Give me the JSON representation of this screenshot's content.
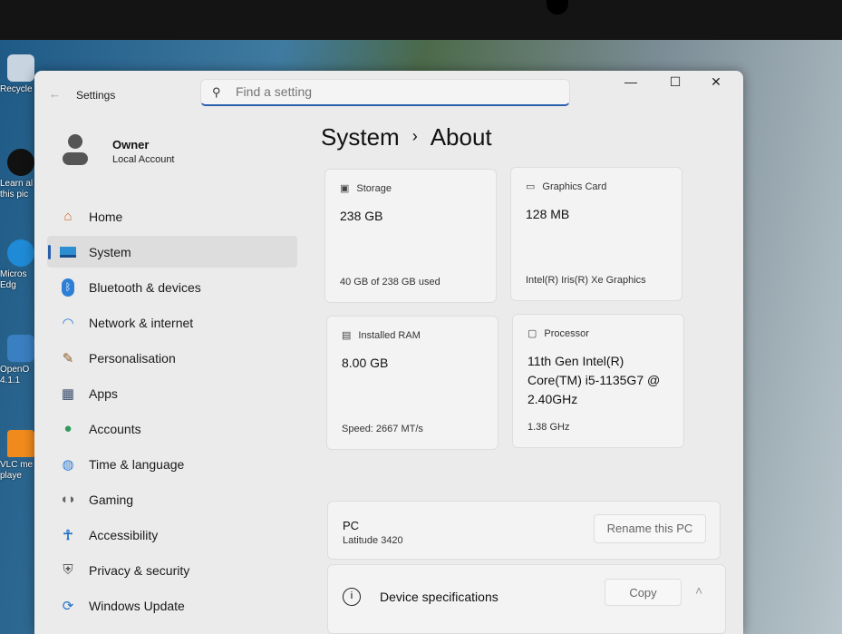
{
  "desktop": {
    "icons": [
      {
        "label": "Recycle"
      },
      {
        "label": "Learn al this pic"
      },
      {
        "label": "Micros Edg"
      },
      {
        "label": "OpenO 4.1.1"
      },
      {
        "label": "VLC me playe"
      }
    ]
  },
  "window": {
    "title": "Settings",
    "search_placeholder": "Find a setting",
    "controls": {
      "minimize": "—",
      "maximize": "☐",
      "close": "✕"
    }
  },
  "user": {
    "name": "Owner",
    "type": "Local Account"
  },
  "nav": [
    {
      "label": "Home",
      "icon": "home-icon"
    },
    {
      "label": "System",
      "icon": "system-icon",
      "selected": true
    },
    {
      "label": "Bluetooth & devices",
      "icon": "bluetooth-icon"
    },
    {
      "label": "Network & internet",
      "icon": "wifi-icon"
    },
    {
      "label": "Personalisation",
      "icon": "brush-icon"
    },
    {
      "label": "Apps",
      "icon": "apps-icon"
    },
    {
      "label": "Accounts",
      "icon": "accounts-icon"
    },
    {
      "label": "Time & language",
      "icon": "globe-clock-icon"
    },
    {
      "label": "Gaming",
      "icon": "gamepad-icon"
    },
    {
      "label": "Accessibility",
      "icon": "accessibility-icon"
    },
    {
      "label": "Privacy & security",
      "icon": "shield-icon"
    },
    {
      "label": "Windows Update",
      "icon": "update-icon"
    }
  ],
  "breadcrumb": {
    "parent": "System",
    "sep": "›",
    "current": "About"
  },
  "cards": {
    "storage": {
      "label": "Storage",
      "value": "238 GB",
      "sub": "40 GB of 238 GB used",
      "used_fraction": 0.168
    },
    "graphics": {
      "label": "Graphics Card",
      "value": "128 MB",
      "sub": "Intel(R) Iris(R) Xe Graphics"
    },
    "ram": {
      "label": "Installed RAM",
      "value": "8.00 GB",
      "sub": "Speed: 2667 MT/s"
    },
    "processor": {
      "label": "Processor",
      "value": "11th Gen Intel(R) Core(TM) i5-1135G7 @ 2.40GHz",
      "sub": "1.38 GHz"
    }
  },
  "pc": {
    "label": "PC",
    "model": "Latitude 3420",
    "rename": "Rename this PC"
  },
  "specs": {
    "label": "Device specifications",
    "copy": "Copy"
  }
}
